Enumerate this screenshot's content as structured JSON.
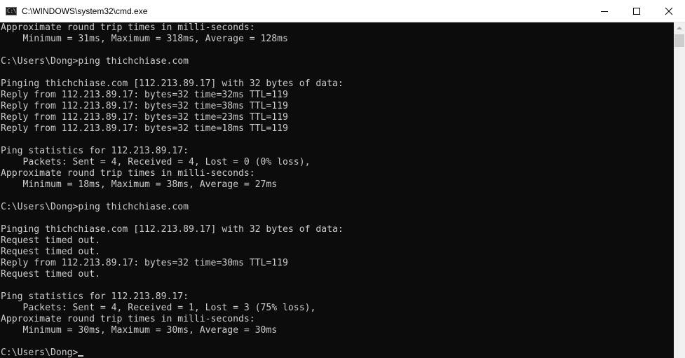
{
  "window": {
    "title": "C:\\WINDOWS\\system32\\cmd.exe",
    "icon": "console-icon",
    "icon_glyph": "C:\\",
    "controls": {
      "minimize": "minimize-icon",
      "maximize": "maximize-icon",
      "close": "close-icon"
    }
  },
  "console": {
    "text_color": "#cccccc",
    "background_color": "#0c0c0c",
    "lines": [
      "Approximate round trip times in milli-seconds:",
      "    Minimum = 31ms, Maximum = 318ms, Average = 128ms",
      "",
      "C:\\Users\\Dong>ping thichchiase.com",
      "",
      "Pinging thichchiase.com [112.213.89.17] with 32 bytes of data:",
      "Reply from 112.213.89.17: bytes=32 time=32ms TTL=119",
      "Reply from 112.213.89.17: bytes=32 time=38ms TTL=119",
      "Reply from 112.213.89.17: bytes=32 time=23ms TTL=119",
      "Reply from 112.213.89.17: bytes=32 time=18ms TTL=119",
      "",
      "Ping statistics for 112.213.89.17:",
      "    Packets: Sent = 4, Received = 4, Lost = 0 (0% loss),",
      "Approximate round trip times in milli-seconds:",
      "    Minimum = 18ms, Maximum = 38ms, Average = 27ms",
      "",
      "C:\\Users\\Dong>ping thichchiase.com",
      "",
      "Pinging thichchiase.com [112.213.89.17] with 32 bytes of data:",
      "Request timed out.",
      "Request timed out.",
      "Reply from 112.213.89.17: bytes=32 time=30ms TTL=119",
      "Request timed out.",
      "",
      "Ping statistics for 112.213.89.17:",
      "    Packets: Sent = 4, Received = 1, Lost = 3 (75% loss),",
      "Approximate round trip times in milli-seconds:",
      "    Minimum = 30ms, Maximum = 30ms, Average = 30ms",
      ""
    ],
    "prompt": "C:\\Users\\Dong>"
  },
  "scrollbar": {
    "up_arrow": "chevron-up-icon"
  }
}
